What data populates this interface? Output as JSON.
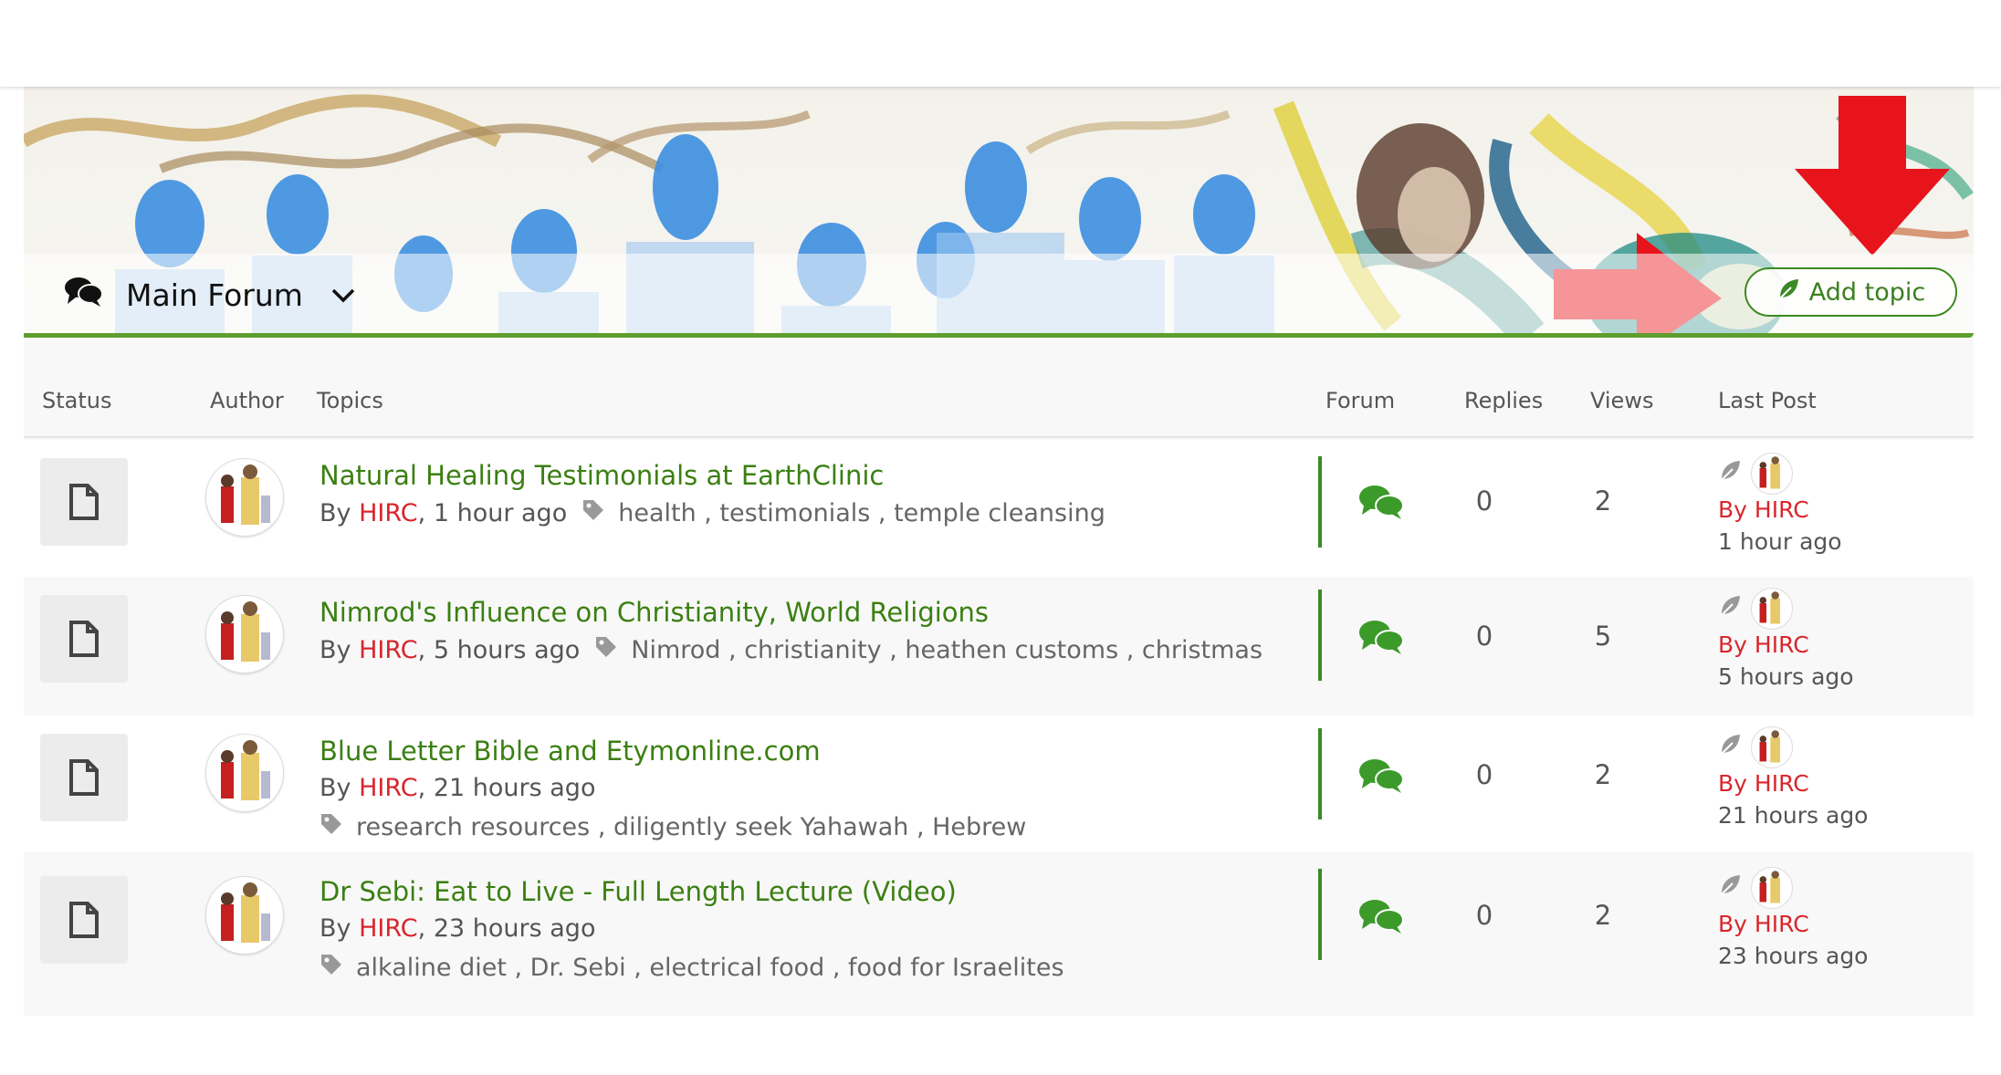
{
  "forum": {
    "title": "Main Forum",
    "add_topic_label": "Add topic"
  },
  "columns": {
    "status": "Status",
    "author": "Author",
    "topics": "Topics",
    "forum": "Forum",
    "replies": "Replies",
    "views": "Views",
    "last_post": "Last Post"
  },
  "topics": [
    {
      "title": "Natural Healing Testimonials at EarthClinic",
      "by": "By",
      "user": "HIRC",
      "time": ", 1 hour ago",
      "tags": "health , testimonials , temple cleansing",
      "replies": "0",
      "views": "2",
      "last_by": "By HIRC",
      "last_time": "1 hour ago"
    },
    {
      "title": "Nimrod's Influence on Christianity, World Religions",
      "by": "By",
      "user": "HIRC",
      "time": ", 5 hours ago",
      "tags": "Nimrod , christianity , heathen customs , christmas",
      "replies": "0",
      "views": "5",
      "last_by": "By HIRC",
      "last_time": "5 hours ago"
    },
    {
      "title": "Blue Letter Bible and Etymonline.com",
      "by": "By",
      "user": "HIRC",
      "time": ", 21 hours ago",
      "tags": "research resources , diligently seek Yahawah , Hebrew",
      "replies": "0",
      "views": "2",
      "last_by": "By HIRC",
      "last_time": "21 hours ago"
    },
    {
      "title": "Dr Sebi: Eat to Live - Full Length Lecture (Video)",
      "by": "By",
      "user": "HIRC",
      "time": ", 23 hours ago",
      "tags": "alkaline diet , Dr. Sebi , electrical food , food for Israelites",
      "replies": "0",
      "views": "2",
      "last_by": "By HIRC",
      "last_time": "23 hours ago"
    }
  ],
  "colors": {
    "accent_green": "#3b7f12",
    "line_green": "#5e9e2c",
    "user_red": "#d8262d",
    "arrow_red": "#e8141c"
  }
}
